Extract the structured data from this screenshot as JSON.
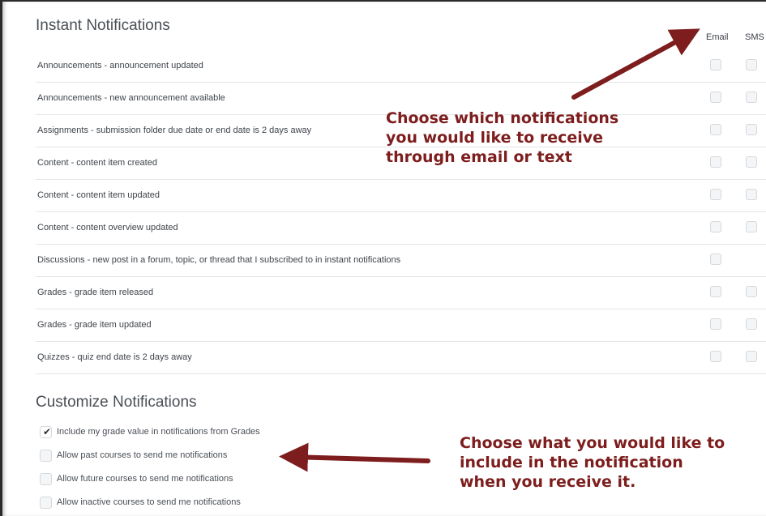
{
  "instant": {
    "title": "Instant Notifications",
    "email_label": "Email",
    "sms_label": "SMS",
    "rows": [
      {
        "label": "Announcements - announcement updated",
        "email": false,
        "sms": false
      },
      {
        "label": "Announcements - new announcement available",
        "email": false,
        "sms": false
      },
      {
        "label": "Assignments - submission folder due date or end date is 2 days away",
        "email": false,
        "sms": false
      },
      {
        "label": "Content - content item created",
        "email": false,
        "sms": false
      },
      {
        "label": "Content - content item updated",
        "email": false,
        "sms": false
      },
      {
        "label": "Content - content overview updated",
        "email": false,
        "sms": false
      },
      {
        "label": "Discussions - new post in a forum, topic, or thread that I subscribed to in instant notifications",
        "email": false,
        "sms": null
      },
      {
        "label": "Grades - grade item released",
        "email": false,
        "sms": false
      },
      {
        "label": "Grades - grade item updated",
        "email": false,
        "sms": false
      },
      {
        "label": "Quizzes - quiz end date is 2 days away",
        "email": false,
        "sms": false
      }
    ]
  },
  "customize": {
    "title": "Customize Notifications",
    "options": [
      {
        "label": "Include my grade value in notifications from Grades",
        "checked": true
      },
      {
        "label": "Allow past courses to send me notifications",
        "checked": false
      },
      {
        "label": "Allow future courses to send me notifications",
        "checked": false
      },
      {
        "label": "Allow inactive courses to send me notifications",
        "checked": false
      }
    ]
  },
  "callouts": {
    "top": {
      "line1": "Choose which notifications",
      "line2": "you would like to receive",
      "line3": "through email or text"
    },
    "bottom": {
      "line1": "Choose what you would like to",
      "line2": "include in the notification",
      "line3": "when you receive it."
    }
  },
  "colors": {
    "callout": "#7d1d1d",
    "arrow": "#7d1d1d"
  }
}
